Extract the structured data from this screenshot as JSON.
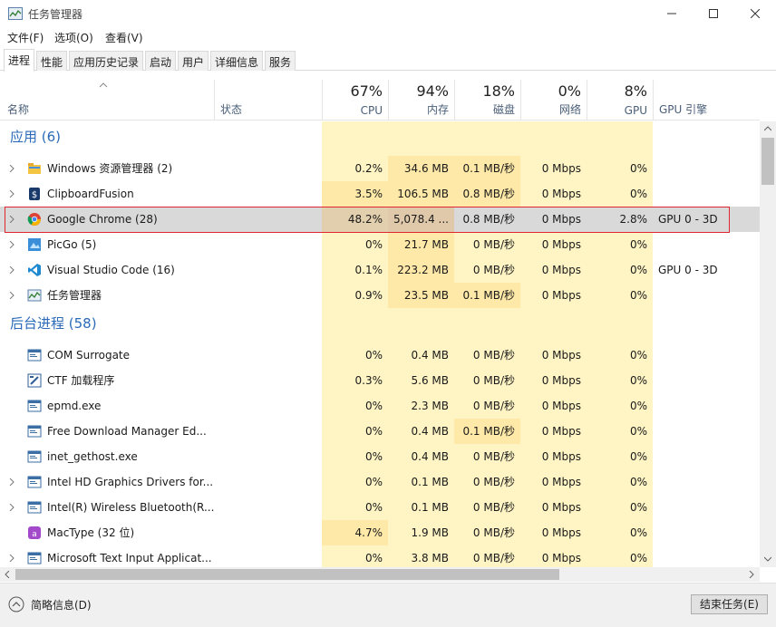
{
  "window": {
    "title": "任务管理器"
  },
  "menu": [
    "文件(F)",
    "选项(O)",
    "查看(V)"
  ],
  "tabs": [
    "进程",
    "性能",
    "应用历史记录",
    "启动",
    "用户",
    "详细信息",
    "服务"
  ],
  "header": {
    "name": "名称",
    "status": "状态",
    "cpu_pct": "67%",
    "cpu": "CPU",
    "mem_pct": "94%",
    "mem": "内存",
    "disk_pct": "18%",
    "disk": "磁盘",
    "net_pct": "0%",
    "net": "网络",
    "gpu_pct": "8%",
    "gpu": "GPU",
    "gpu_engine": "GPU 引擎"
  },
  "groups": {
    "apps": "应用 (6)",
    "background": "后台进程 (58)"
  },
  "processes": [
    {
      "name": "Windows 资源管理器 (2)",
      "icon": "folder-icon",
      "cpu": "0.2%",
      "mem": "34.6 MB",
      "disk": "0.1 MB/秒",
      "net": "0 Mbps",
      "gpu": "0%",
      "engine": ""
    },
    {
      "name": "ClipboardFusion",
      "icon": "clipboard-icon",
      "cpu": "3.5%",
      "mem": "106.5 MB",
      "disk": "0.8 MB/秒",
      "net": "0 Mbps",
      "gpu": "0%",
      "engine": ""
    },
    {
      "name": "Google Chrome (28)",
      "icon": "chrome-icon",
      "cpu": "48.2%",
      "mem": "5,078.4 ...",
      "disk": "0.8 MB/秒",
      "net": "0 Mbps",
      "gpu": "2.8%",
      "engine": "GPU 0 - 3D"
    },
    {
      "name": "PicGo (5)",
      "icon": "picgo-icon",
      "cpu": "0%",
      "mem": "21.7 MB",
      "disk": "0 MB/秒",
      "net": "0 Mbps",
      "gpu": "0%",
      "engine": ""
    },
    {
      "name": "Visual Studio Code (16)",
      "icon": "vscode-icon",
      "cpu": "0.1%",
      "mem": "223.2 MB",
      "disk": "0 MB/秒",
      "net": "0 Mbps",
      "gpu": "0%",
      "engine": "GPU 0 - 3D"
    },
    {
      "name": "任务管理器",
      "icon": "taskmgr-icon",
      "cpu": "0.9%",
      "mem": "23.5 MB",
      "disk": "0.1 MB/秒",
      "net": "0 Mbps",
      "gpu": "0%",
      "engine": ""
    },
    {
      "name": "COM Surrogate",
      "icon": "window-icon",
      "cpu": "0%",
      "mem": "0.4 MB",
      "disk": "0 MB/秒",
      "net": "0 Mbps",
      "gpu": "0%",
      "engine": ""
    },
    {
      "name": "CTF 加载程序",
      "icon": "ctf-icon",
      "cpu": "0.3%",
      "mem": "5.6 MB",
      "disk": "0 MB/秒",
      "net": "0 Mbps",
      "gpu": "0%",
      "engine": ""
    },
    {
      "name": "epmd.exe",
      "icon": "window-icon",
      "cpu": "0%",
      "mem": "2.3 MB",
      "disk": "0 MB/秒",
      "net": "0 Mbps",
      "gpu": "0%",
      "engine": ""
    },
    {
      "name": "Free Download Manager Ed...",
      "icon": "window-icon",
      "cpu": "0%",
      "mem": "0.4 MB",
      "disk": "0.1 MB/秒",
      "net": "0 Mbps",
      "gpu": "0%",
      "engine": ""
    },
    {
      "name": "inet_gethost.exe",
      "icon": "window-icon",
      "cpu": "0%",
      "mem": "0.4 MB",
      "disk": "0 MB/秒",
      "net": "0 Mbps",
      "gpu": "0%",
      "engine": ""
    },
    {
      "name": "Intel HD Graphics Drivers for...",
      "icon": "window-icon",
      "cpu": "0%",
      "mem": "0.1 MB",
      "disk": "0 MB/秒",
      "net": "0 Mbps",
      "gpu": "0%",
      "engine": ""
    },
    {
      "name": "Intel(R) Wireless Bluetooth(R...",
      "icon": "window-icon",
      "cpu": "0%",
      "mem": "0.1 MB",
      "disk": "0 MB/秒",
      "net": "0 Mbps",
      "gpu": "0%",
      "engine": ""
    },
    {
      "name": "MacType (32 位)",
      "icon": "mactype-icon",
      "cpu": "4.7%",
      "mem": "1.9 MB",
      "disk": "0 MB/秒",
      "net": "0 Mbps",
      "gpu": "0%",
      "engine": ""
    },
    {
      "name": "Microsoft Text Input Applicat...",
      "icon": "window-icon",
      "cpu": "0%",
      "mem": "3.8 MB",
      "disk": "0 MB/秒",
      "net": "0 Mbps",
      "gpu": "0%",
      "engine": ""
    }
  ],
  "footer": {
    "fewer_details": "简略信息(D)",
    "end_task": "结束任务(E)"
  },
  "colors": {
    "heat_light": "#fff4c4",
    "heat_mid": "#ffe9a8",
    "heat_high": "#f9d9a6",
    "selected_row": "#d9d9d9",
    "selected_border": "#e0262e",
    "group_title": "#2a6ab8"
  }
}
